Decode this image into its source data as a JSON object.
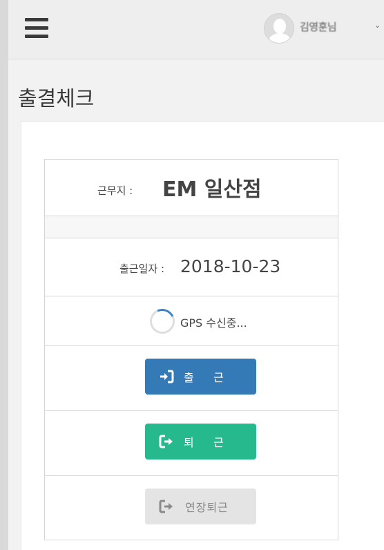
{
  "header": {
    "username": "김영훈님",
    "caret": "⌄"
  },
  "page": {
    "title": "출결체크"
  },
  "checkin": {
    "site_label": "근무지 :",
    "site_value": "EM 일산점",
    "date_label": "출근일자 :",
    "date_value": "2018-10-23",
    "gps_status": "GPS 수신중...",
    "clock_in_label": "출 근",
    "clock_out_label": "퇴 근",
    "overtime_out_label": "연장퇴근"
  },
  "colors": {
    "clock_in": "#337ab7",
    "clock_out": "#26b98d",
    "overtime_disabled": "#e4e4e4"
  }
}
